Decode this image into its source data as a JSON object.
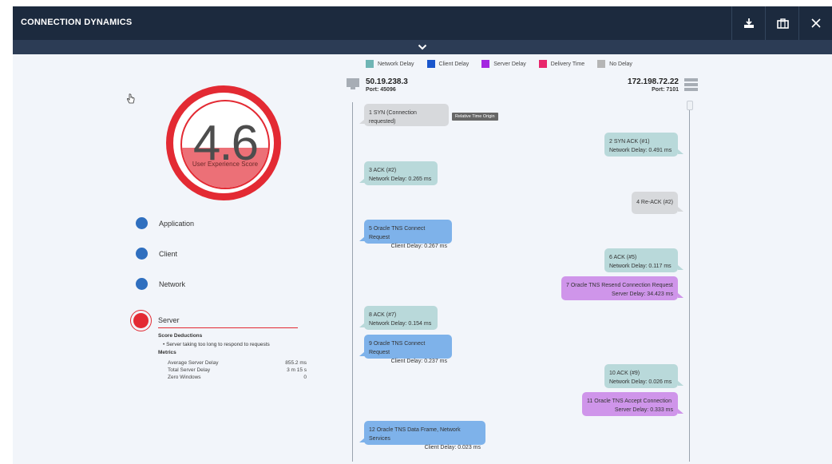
{
  "header": {
    "title": "CONNECTION DYNAMICS",
    "download_icon": "download-icon",
    "briefcase_icon": "briefcase-icon",
    "close_icon": "close-icon"
  },
  "subbar": {
    "chevron_icon": "chevron-down-icon"
  },
  "legend": [
    {
      "label": "Network Delay",
      "color": "#6fb5b5"
    },
    {
      "label": "Client Delay",
      "color": "#1a56cc"
    },
    {
      "label": "Server Delay",
      "color": "#a427e0"
    },
    {
      "label": "Delivery Time",
      "color": "#e8266b"
    },
    {
      "label": "No Delay",
      "color": "#b5b5b5"
    }
  ],
  "client_host": {
    "ip": "50.19.238.3",
    "port": "Port: 45096"
  },
  "server_host": {
    "ip": "172.198.72.22",
    "port": "Port: 7101"
  },
  "relative_time_origin": "Relative Time Origin",
  "messages": [
    {
      "line1": "1  SYN (Connection requested)",
      "line2": ""
    },
    {
      "line1": "2  SYN ACK (#1)",
      "line2": "Network Delay:  0.491 ms"
    },
    {
      "line1": "3  ACK (#2)",
      "line2": "Network Delay:  0.265 ms"
    },
    {
      "line1": "4  Re-ACK (#2)",
      "line2": ""
    },
    {
      "line1": "5  Oracle TNS Connect Request",
      "line2": "Client Delay:  0.267 ms"
    },
    {
      "line1": "6  ACK (#5)",
      "line2": "Network Delay:  0.117 ms"
    },
    {
      "line1": "7  Oracle TNS Resend Connection Request",
      "line2": "Server Delay:  34.423 ms"
    },
    {
      "line1": "8  ACK (#7)",
      "line2": "Network Delay:  0.154 ms"
    },
    {
      "line1": "9  Oracle TNS Connect Request",
      "line2": "Client Delay:  0.237 ms"
    },
    {
      "line1": "10  ACK (#9)",
      "line2": "Network Delay:  0.026 ms"
    },
    {
      "line1": "11  Oracle TNS Accept Connection",
      "line2": "Server Delay:  0.333 ms"
    },
    {
      "line1": "12  Oracle TNS Data Frame, Network Services",
      "line2": "Client Delay:  0.023 ms"
    }
  ],
  "score": {
    "value": "4.6",
    "label": "User Experience Score",
    "fill_fraction": 0.46
  },
  "categories": [
    "Application",
    "Client",
    "Network"
  ],
  "server": {
    "label": "Server",
    "deductions_title": "Score Deductions",
    "deduction": "Server taking too long to respond to requests",
    "metrics_title": "Metrics",
    "metrics": [
      {
        "name": "Average Server Delay",
        "value": "855.2 ms"
      },
      {
        "name": "Total Server Delay",
        "value": "3 m 15 s"
      },
      {
        "name": "Zero Windows",
        "value": "0"
      }
    ]
  }
}
